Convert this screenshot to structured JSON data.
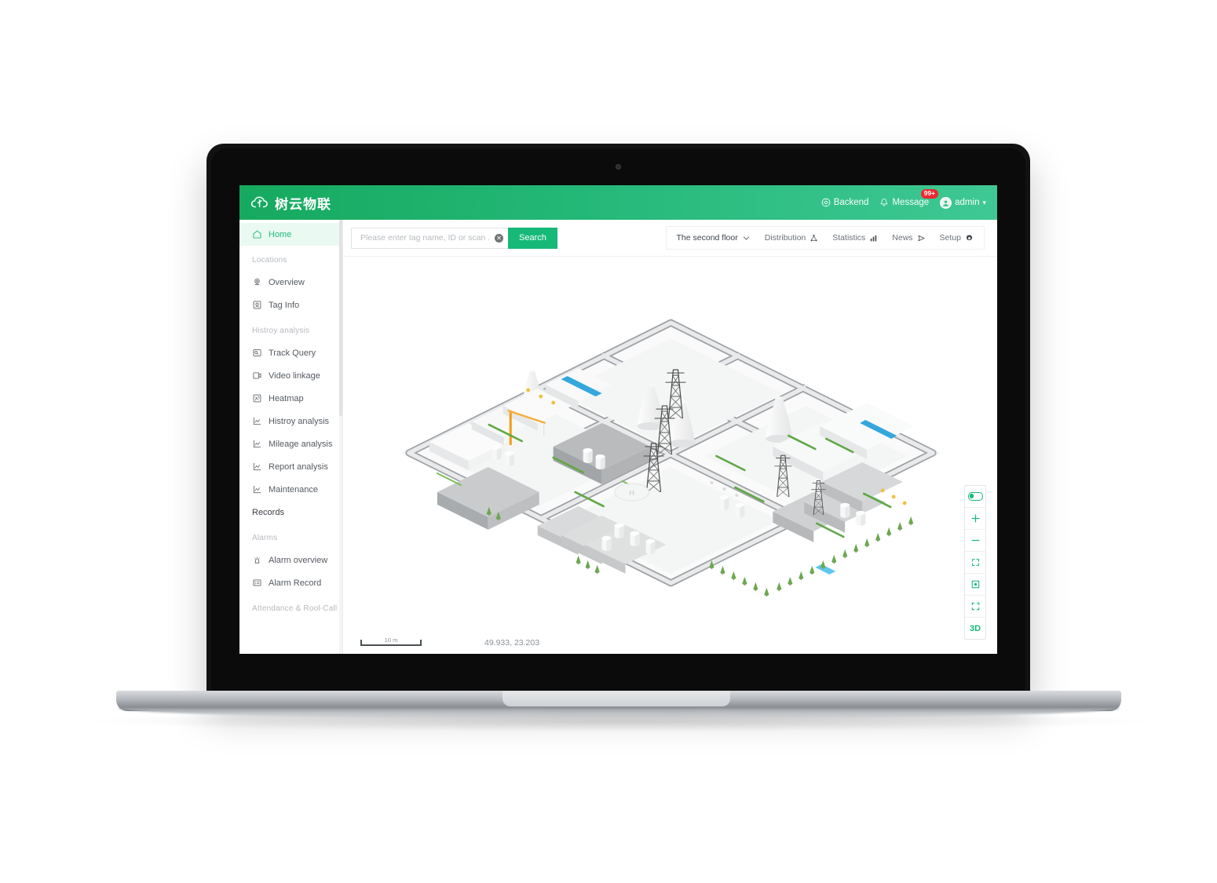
{
  "header": {
    "brand_name": "树云物联",
    "logo_icon": "cloud-tree-icon",
    "backend_label": "Backend",
    "backend_icon": "gear-circle-icon",
    "message_label": "Message",
    "message_icon": "bell-icon",
    "message_badge": "99+",
    "user_name": "admin",
    "user_icon": "avatar-icon",
    "chevron_icon": "chevron-down-icon"
  },
  "sidebar": {
    "items": [
      {
        "label": "Home",
        "icon": "home-icon",
        "type": "item",
        "active": true
      },
      {
        "label": "Locations",
        "type": "group"
      },
      {
        "label": "Overview",
        "icon": "location-pin-icon",
        "type": "item"
      },
      {
        "label": "Tag Info",
        "icon": "tag-info-icon",
        "type": "item"
      },
      {
        "label": "Histroy analysis",
        "type": "group"
      },
      {
        "label": "Track Query",
        "icon": "track-query-icon",
        "type": "item"
      },
      {
        "label": "Video linkage",
        "icon": "video-icon",
        "type": "item"
      },
      {
        "label": "Heatmap",
        "icon": "heatmap-icon",
        "type": "item"
      },
      {
        "label": "Histroy analysis",
        "icon": "chart-line-icon",
        "type": "item"
      },
      {
        "label": "Mileage analysis",
        "icon": "chart-line-icon",
        "type": "item"
      },
      {
        "label": "Report analysis",
        "icon": "chart-line-icon",
        "type": "item"
      },
      {
        "label": "Maintenance",
        "icon": "chart-line-icon",
        "type": "item"
      },
      {
        "label": "Records",
        "type": "plain"
      },
      {
        "label": "Alarms",
        "type": "group"
      },
      {
        "label": "Alarm overview",
        "icon": "alarm-light-icon",
        "type": "item"
      },
      {
        "label": "Alarm Record",
        "icon": "alarm-record-icon",
        "type": "item"
      },
      {
        "label": "Attendance & Rool-Call",
        "type": "group"
      }
    ]
  },
  "search": {
    "value": "",
    "placeholder": "Please enter tag name, ID or scan .",
    "clear_icon": "clear-circle-icon",
    "button_label": "Search"
  },
  "toolbar": {
    "floor_selector": "The second floor",
    "floor_chevron_icon": "chevron-down-icon",
    "items": [
      {
        "label": "Distribution",
        "icon": "distribution-tree-icon"
      },
      {
        "label": "Statistics",
        "icon": "bar-chart-icon"
      },
      {
        "label": "News",
        "icon": "send-icon"
      },
      {
        "label": "Setup",
        "icon": "gear-icon"
      }
    ]
  },
  "map": {
    "scale_label": "10 m",
    "coordinates": "49.933, 23.203",
    "controls": [
      {
        "name": "layer-toggle",
        "icon": "toggle-switch-icon",
        "label": ""
      },
      {
        "name": "zoom-in",
        "icon": "plus-icon",
        "label": "+"
      },
      {
        "name": "zoom-out",
        "icon": "minus-icon",
        "label": "−"
      },
      {
        "name": "fit-view",
        "icon": "expand-arrows-icon",
        "label": ""
      },
      {
        "name": "select-area",
        "icon": "target-crop-icon",
        "label": ""
      },
      {
        "name": "fullscreen",
        "icon": "fullscreen-icon",
        "label": ""
      },
      {
        "name": "view-mode-3d",
        "icon": "3d-icon",
        "label": "3D"
      }
    ]
  },
  "colors": {
    "brand_green": "#16a95f",
    "header_gradient_end": "#3fc894",
    "accent_green": "#16b978",
    "active_bg": "#eaf9f1",
    "badge_red": "#f5222d",
    "map_road": "#9a9da1",
    "map_building": "#f2f3f4"
  }
}
